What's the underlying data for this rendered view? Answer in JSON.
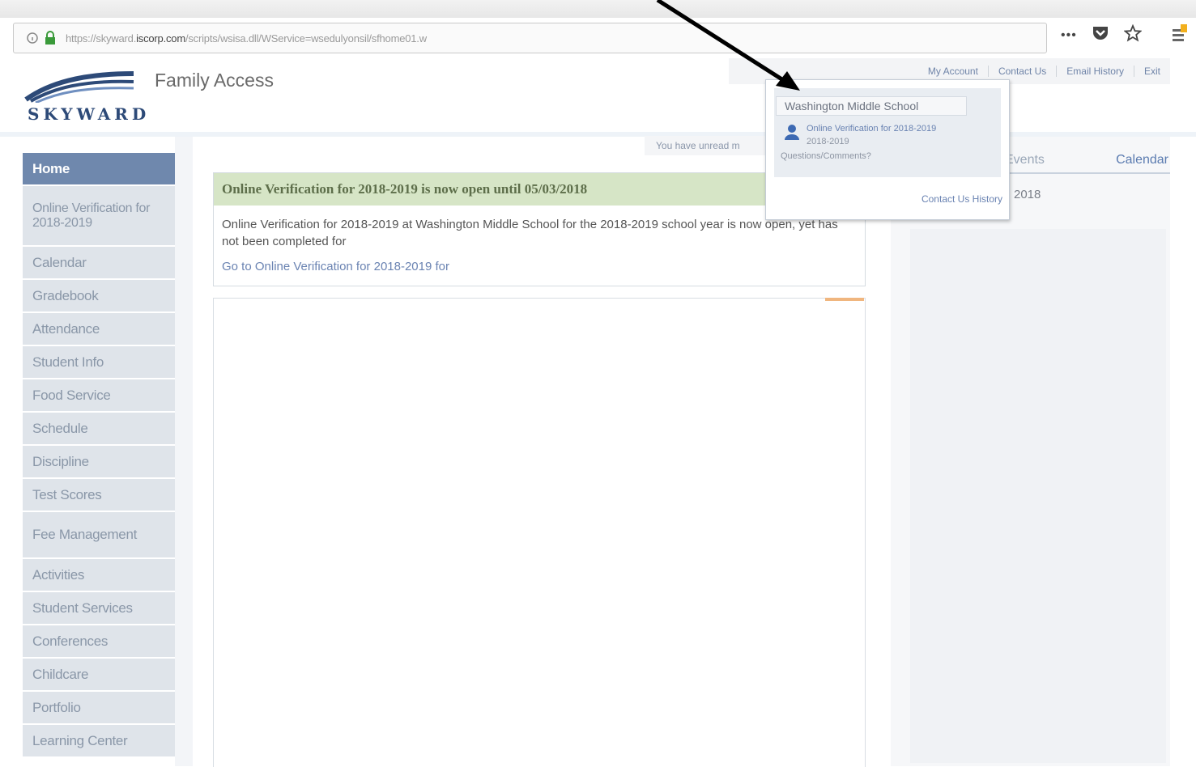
{
  "browser": {
    "url_prefix": "https://skyward.",
    "url_domain": "iscorp.com",
    "url_path": "/scripts/wsisa.dll/WService=wsedulyonsil/sfhome01.w",
    "more_label": "•••",
    "pocket_icon": "pocket-icon",
    "star_icon": "bookmark-star-icon"
  },
  "header": {
    "logo_text": "SKYWARD",
    "app_title": "Family Access",
    "links": [
      "My Account",
      "Contact Us",
      "Email History",
      "Exit"
    ]
  },
  "sidebar": {
    "items": [
      {
        "label": "Home",
        "active": true
      },
      {
        "label": "Online Verification for 2018-2019",
        "tall": true
      },
      {
        "label": "Calendar"
      },
      {
        "label": "Gradebook"
      },
      {
        "label": "Attendance"
      },
      {
        "label": "Student Info"
      },
      {
        "label": "Food Service"
      },
      {
        "label": "Schedule"
      },
      {
        "label": "Discipline"
      },
      {
        "label": "Test Scores"
      },
      {
        "label": "Fee Management",
        "mid": true
      },
      {
        "label": "Activities"
      },
      {
        "label": "Student Services"
      },
      {
        "label": "Conferences"
      },
      {
        "label": "Childcare"
      },
      {
        "label": "Portfolio"
      },
      {
        "label": "Learning Center"
      }
    ]
  },
  "main": {
    "unread_text": "You have unread m",
    "verification": {
      "heading": "Online Verification for 2018-2019 is now open until 05/03/2018",
      "body": "Online Verification for 2018-2019 at Washington Middle School for the 2018-2019 school year is now open, yet has not been completed for",
      "link": "Go to Online Verification for 2018-2019 for"
    }
  },
  "right": {
    "tab_events": "Events",
    "tab_calendar": "Calendar",
    "date_text": "2018"
  },
  "popup": {
    "school": "Washington Middle School",
    "entry_line1": "Online Verification for 2018-2019",
    "entry_line2": "2018-2019",
    "entry_line3": "Questions/Comments?",
    "contact_history": "Contact Us History"
  }
}
